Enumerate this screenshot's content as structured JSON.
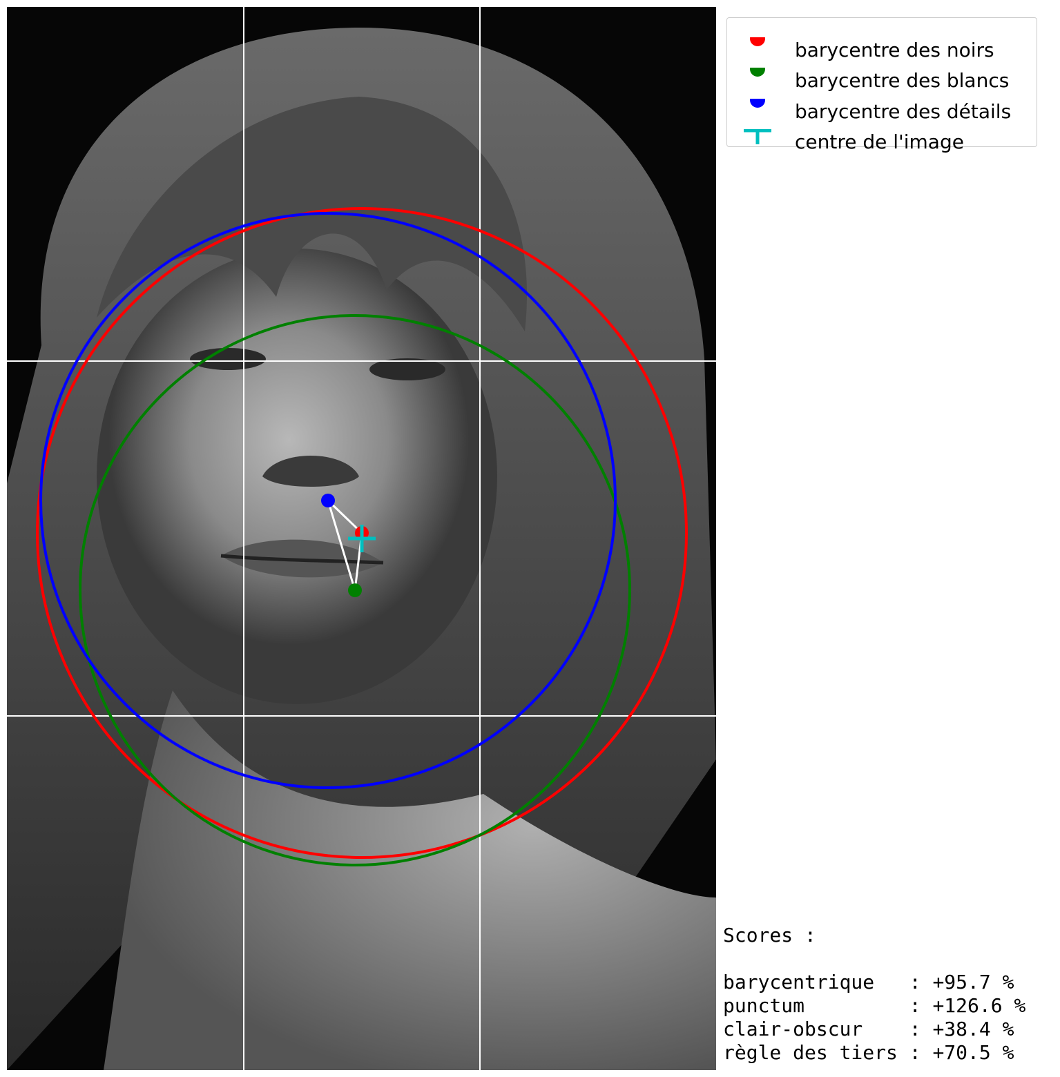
{
  "legend": {
    "items": [
      {
        "label": "barycentre des noirs",
        "color": "#ff0000",
        "marker": "dot"
      },
      {
        "label": "barycentre des blancs",
        "color": "#008000",
        "marker": "dot"
      },
      {
        "label": "barycentre des détails",
        "color": "#0000ff",
        "marker": "dot"
      },
      {
        "label": "centre de l'image",
        "color": "#00bfbf",
        "marker": "plus"
      }
    ]
  },
  "scores": {
    "title": "Scores :",
    "rows": [
      {
        "label": "barycentrique  ",
        "value": ": +95.7 %"
      },
      {
        "label": "punctum        ",
        "value": ": +126.6 %"
      },
      {
        "label": "clair-obscur   ",
        "value": ": +38.4 %"
      },
      {
        "label": "règle des tiers",
        "value": ": +70.5 %"
      }
    ]
  },
  "colors": {
    "noirs": "#ff0000",
    "blancs": "#008000",
    "details": "#0000ff",
    "centre": "#00bfbf",
    "grid": "#ffffff"
  },
  "photo": {
    "description_icon": "portrait-photo-icon"
  }
}
